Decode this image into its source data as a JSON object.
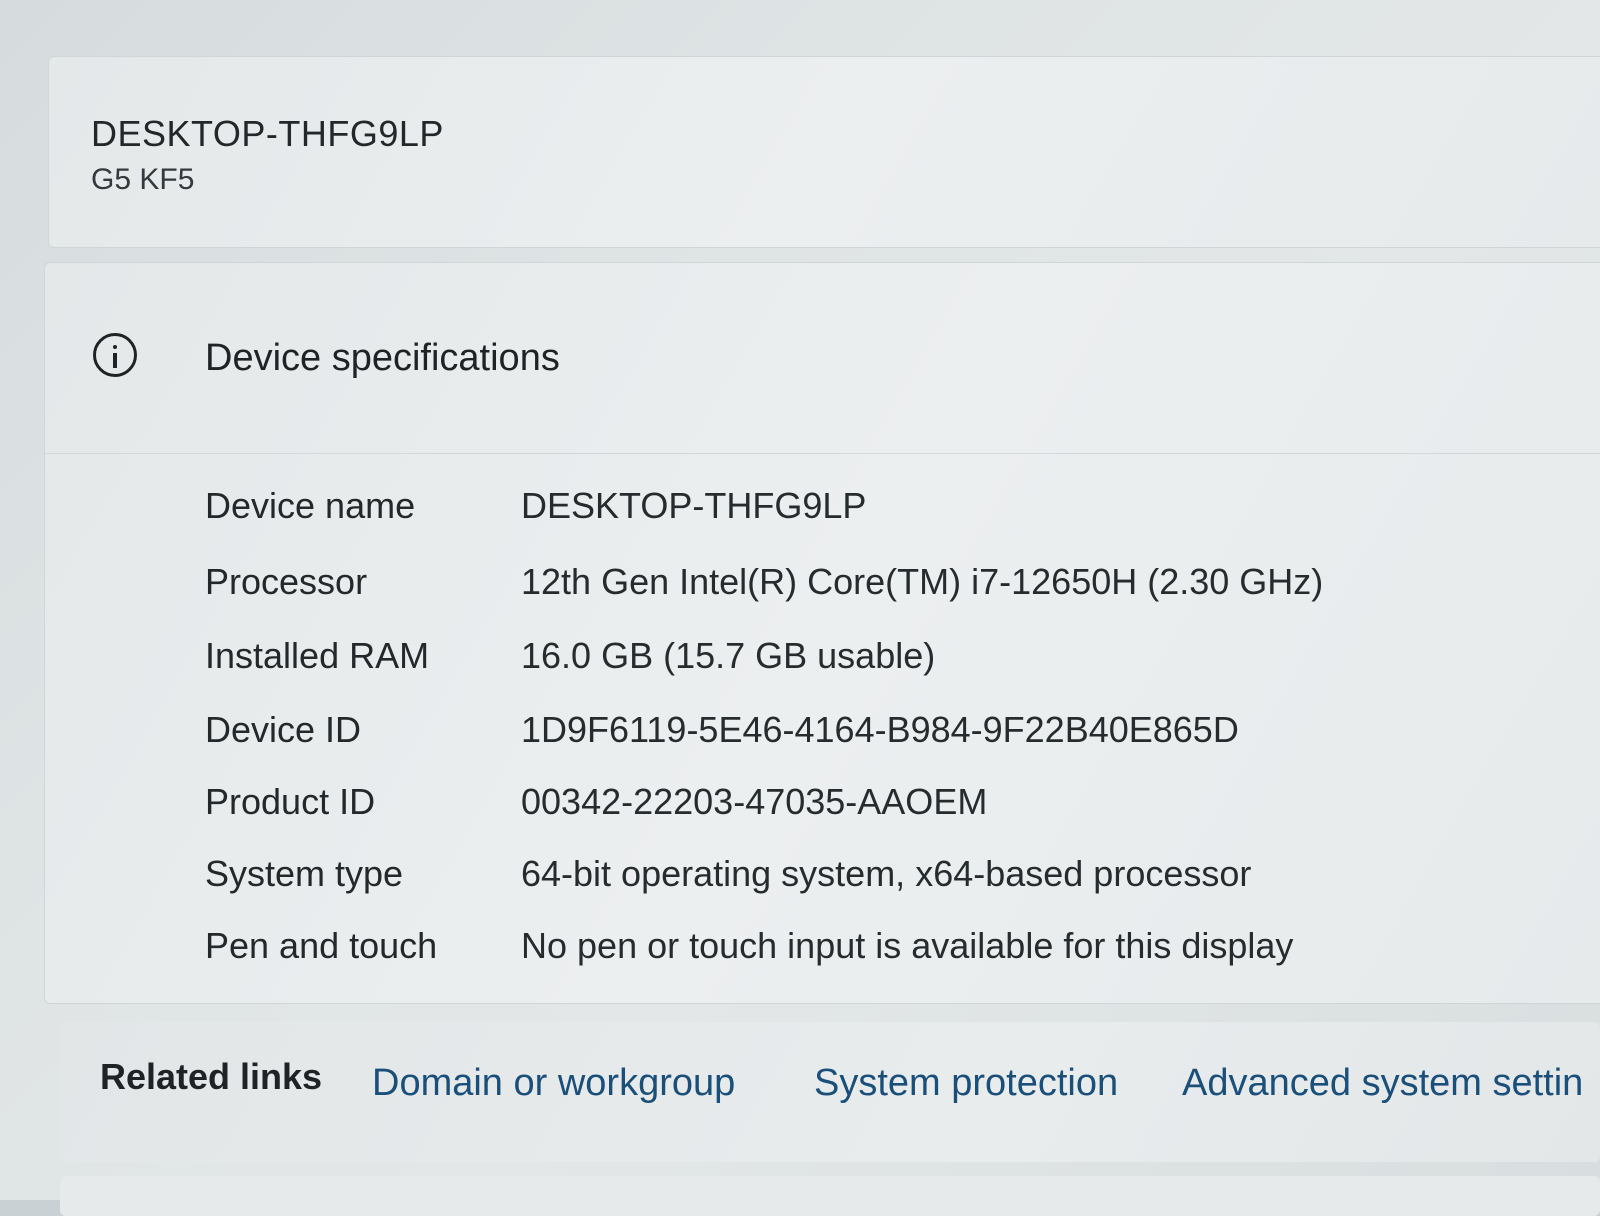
{
  "device": {
    "name": "DESKTOP-THFG9LP",
    "model": "G5 KF5"
  },
  "specs": {
    "title": "Device specifications",
    "rows": [
      {
        "label": "Device name",
        "value": "DESKTOP-THFG9LP"
      },
      {
        "label": "Processor",
        "value": "12th Gen Intel(R) Core(TM) i7-12650H (2.30 GHz)"
      },
      {
        "label": "Installed RAM",
        "value": "16.0 GB (15.7 GB usable)"
      },
      {
        "label": "Device ID",
        "value": "1D9F6119-5E46-4164-B984-9F22B40E865D"
      },
      {
        "label": "Product ID",
        "value": "00342-22203-47035-AAOEM"
      },
      {
        "label": "System type",
        "value": "64-bit operating system, x64-based processor"
      },
      {
        "label": "Pen and touch",
        "value": "No pen or touch input is available for this display"
      }
    ]
  },
  "related": {
    "title": "Related links",
    "links": [
      {
        "label": "Domain or workgroup"
      },
      {
        "label": "System protection"
      },
      {
        "label": "Advanced system settin"
      }
    ]
  },
  "icons": {
    "specs_icon": "info-icon"
  },
  "colors": {
    "link": "#1a4f7a",
    "text": "#1f2326"
  }
}
